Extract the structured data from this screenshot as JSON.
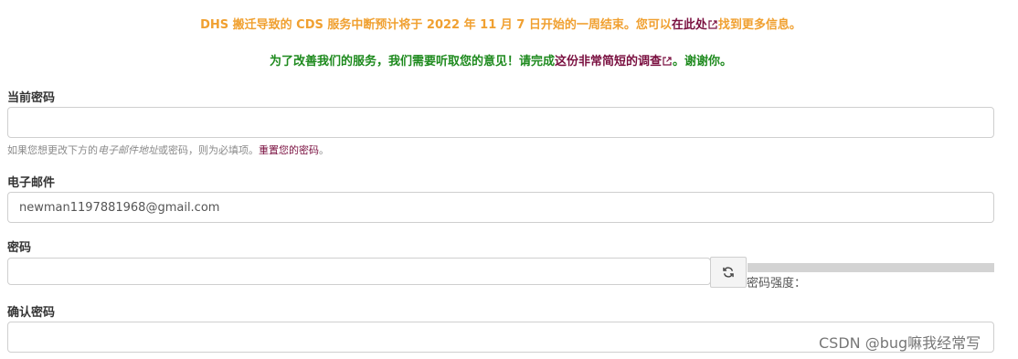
{
  "notices": {
    "outage": {
      "prefix": "DHS 搬迁导致的 CDS 服务中断预计将于 2022 年 11 月 7 日开始的一周结束。您可以",
      "link": "在此处",
      "suffix": "找到更多信息。"
    },
    "survey": {
      "prefix": "为了改善我们的服务，我们需要听取您的意见！请完成",
      "link": "这份非常简短的调查",
      "suffix": "。谢谢你。"
    }
  },
  "form": {
    "current_password": {
      "label": "当前密码",
      "value": ""
    },
    "help": {
      "part1": "如果您想更改下方的",
      "emphasis": "电子邮件地址",
      "part2": "或密码，则为必填项。",
      "link": "重置您的密码",
      "part3": "。"
    },
    "email": {
      "label": "电子邮件",
      "value": "newman1197881968@gmail.com"
    },
    "password": {
      "label": "密码",
      "value": "",
      "strength_label": "密码强度：",
      "strength": 0
    },
    "confirm_password": {
      "label": "确认密码",
      "value": ""
    }
  },
  "watermark": "CSDN @bug嘛我经常写",
  "colors": {
    "outage_notice": "#f0a030",
    "survey_notice": "#1e8a1e",
    "link": "#7a1040",
    "strength_bar_empty": "#d3d3d3"
  },
  "icons": {
    "external_link": "external-link-icon",
    "refresh": "refresh-icon"
  }
}
